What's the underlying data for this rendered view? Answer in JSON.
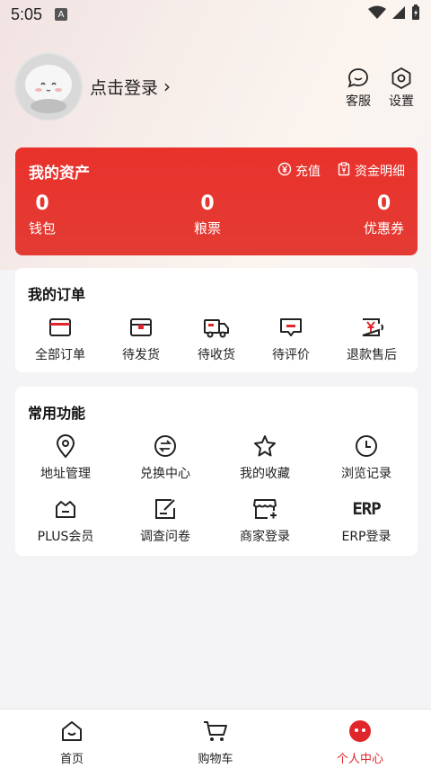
{
  "status_bar": {
    "time": "5:05",
    "badge": "A"
  },
  "profile": {
    "login_text": "点击登录",
    "chevron": "›",
    "actions": [
      {
        "label": "客服",
        "icon": "chat-icon"
      },
      {
        "label": "设置",
        "icon": "gear-icon"
      }
    ]
  },
  "assets": {
    "title": "我的资产",
    "links": [
      {
        "label": "充值",
        "icon": "yen-circle-icon"
      },
      {
        "label": "资金明细",
        "icon": "clipboard-yen-icon"
      }
    ],
    "items": [
      {
        "value": "0",
        "label": "钱包"
      },
      {
        "value": "0",
        "label": "粮票"
      },
      {
        "value": "0",
        "label": "优惠券"
      }
    ]
  },
  "orders": {
    "title": "我的订单",
    "items": [
      {
        "label": "全部订单",
        "icon": "card-icon"
      },
      {
        "label": "待发货",
        "icon": "box-icon"
      },
      {
        "label": "待收货",
        "icon": "truck-icon"
      },
      {
        "label": "待评价",
        "icon": "comment-icon"
      },
      {
        "label": "退款售后",
        "icon": "refund-icon"
      }
    ]
  },
  "functions": {
    "title": "常用功能",
    "items": [
      {
        "label": "地址管理",
        "icon": "location-pin-icon"
      },
      {
        "label": "兑换中心",
        "icon": "exchange-icon"
      },
      {
        "label": "我的收藏",
        "icon": "star-icon"
      },
      {
        "label": "浏览记录",
        "icon": "clock-icon"
      },
      {
        "label": "PLUS会员",
        "icon": "crown-basket-icon"
      },
      {
        "label": "调查问卷",
        "icon": "survey-edit-icon"
      },
      {
        "label": "商家登录",
        "icon": "store-icon"
      },
      {
        "label": "ERP登录",
        "icon": "erp-icon",
        "icon_text": "ERP"
      }
    ]
  },
  "tabbar": {
    "tabs": [
      {
        "label": "首页",
        "icon": "home-icon"
      },
      {
        "label": "购物车",
        "icon": "cart-icon"
      },
      {
        "label": "个人中心",
        "icon": "profile-face-icon",
        "active": true
      }
    ]
  },
  "colors": {
    "accent": "#e0262b",
    "asset_bg": "#e9322c"
  }
}
